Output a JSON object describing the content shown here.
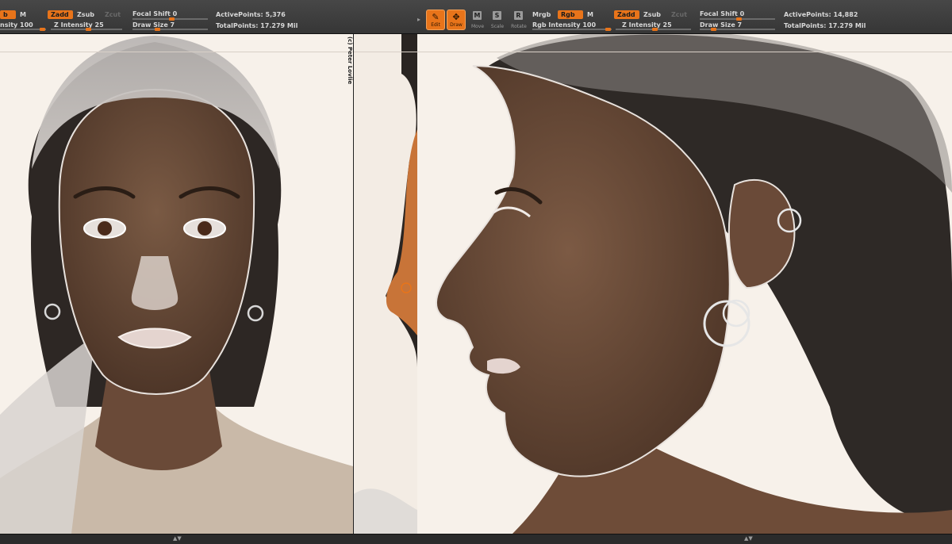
{
  "left_toolbar": {
    "rgb_pill": "b",
    "m_label": "M",
    "zadd": "Zadd",
    "zsub": "Zsub",
    "zcut": "Zcut",
    "focal_shift": "Focal Shift 0",
    "draw_size": "Draw Size 7",
    "rgb_intensity": "nsity 100",
    "z_intensity": "Z Intensity 25",
    "active_points": "ActivePoints: 5,376",
    "total_points": "TotalPoints: 17.279 Mil"
  },
  "right_toolbar": {
    "edit": "Edit",
    "draw": "Draw",
    "move": "Move",
    "scale": "Scale",
    "rotate": "Rotate",
    "mrgb": "Mrgb",
    "rgb": "Rgb",
    "m_label": "M",
    "rgb_intensity": "Rgb Intensity 100",
    "zadd": "Zadd",
    "zsub": "Zsub",
    "zcut": "Zcut",
    "z_intensity": "Z Intensity 25",
    "focal_shift": "Focal Shift 0",
    "draw_size": "Draw Size 7",
    "active_points": "ActivePoints: 14,882",
    "total_points": "TotalPoints: 17.279 Mil"
  },
  "watermark": "(c) Peter Lovlie",
  "icons": {
    "edit": "edit-icon",
    "draw": "draw-icon",
    "move": "move-icon",
    "scale": "scale-icon",
    "rotate": "rotate-icon",
    "collapse": "collapse-arrows-icon"
  },
  "colors": {
    "accent": "#e8741a",
    "toolbar_bg": "#3a3a3a",
    "canvas_bg": "#f7f1ea",
    "skin": "#6b4a36",
    "hair": "#2a2522",
    "mesh_overlay": "#c8c3c0"
  }
}
